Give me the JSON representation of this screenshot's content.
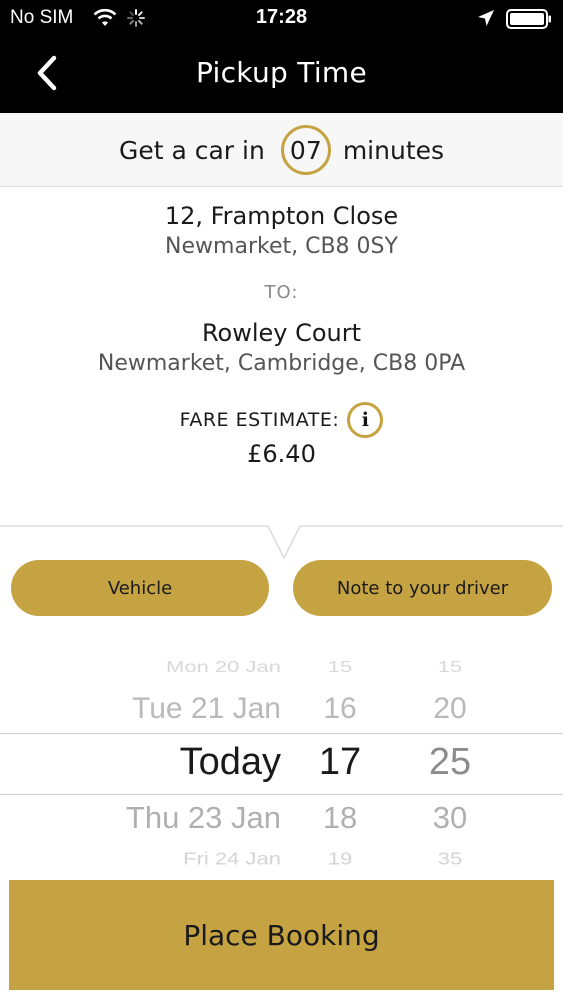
{
  "status_bar": {
    "carrier": "No SIM",
    "time": "17:28",
    "battery_level": 1.0
  },
  "nav": {
    "title": "Pickup Time",
    "back_icon": "chevron-left-icon"
  },
  "eta": {
    "prefix": "Get a car in",
    "minutes": "07",
    "suffix": "minutes"
  },
  "pickup": {
    "line1": "12, Frampton Close",
    "line2": "Newmarket, CB8 0SY"
  },
  "to_label": "TO:",
  "destination": {
    "line1": "Rowley Court",
    "line2": "Newmarket, Cambridge, CB8 0PA"
  },
  "fare": {
    "label": "FARE ESTIMATE:",
    "info_icon_glyph": "i",
    "value": "£6.40"
  },
  "buttons": {
    "vehicle": "Vehicle",
    "note": "Note to your driver",
    "place_booking": "Place Booking"
  },
  "picker": {
    "dates": [
      "Mon 20 Jan",
      "Tue 21 Jan",
      "Today",
      "Thu 23 Jan",
      "Fri 24 Jan"
    ],
    "hours": [
      "15",
      "16",
      "17",
      "18",
      "19"
    ],
    "minutes": [
      "15",
      "20",
      "25",
      "30",
      "35"
    ],
    "selected_index": 2
  },
  "colors": {
    "accent": "#c5a342",
    "header_bg": "#000000"
  }
}
